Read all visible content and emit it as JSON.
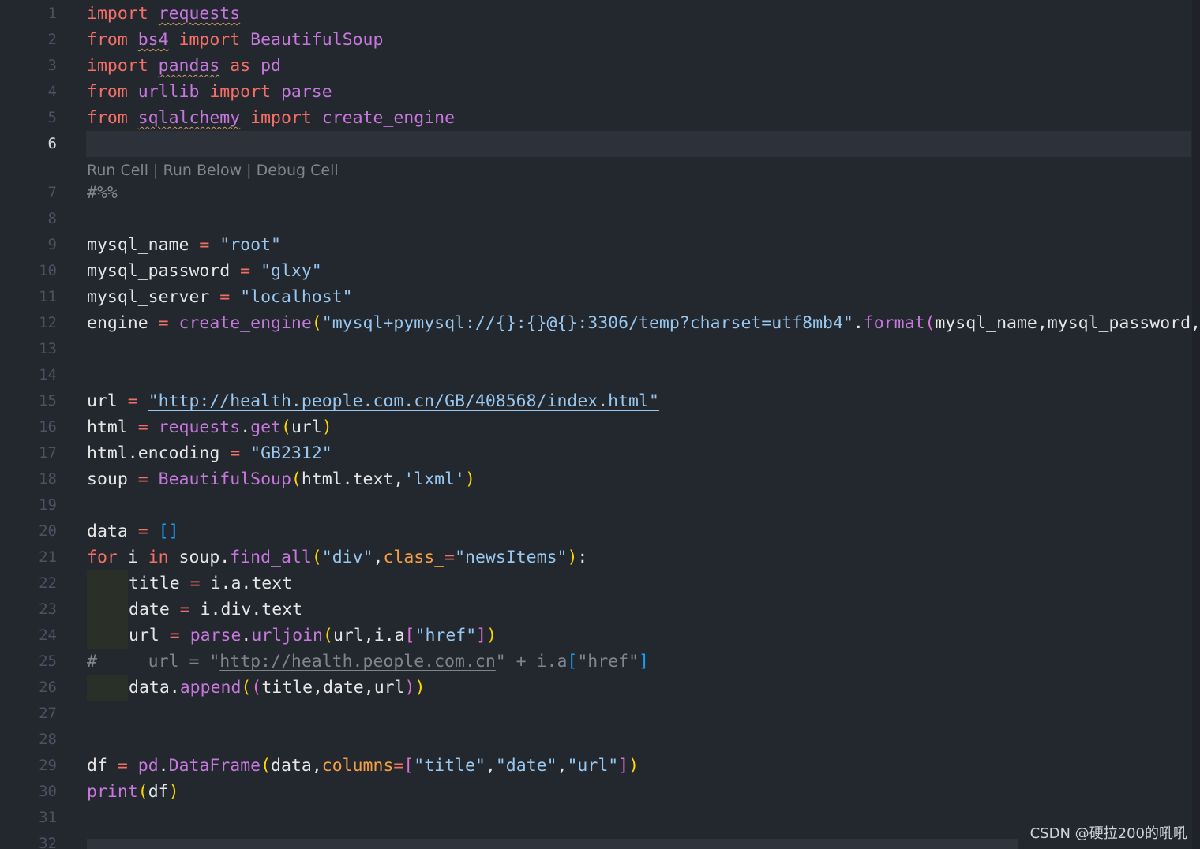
{
  "editor": {
    "current_line": "6",
    "codelens": {
      "run_cell": "Run Cell",
      "sep1": " | ",
      "run_below": "Run Below",
      "sep2": " | ",
      "debug_cell": "Debug Cell"
    },
    "line_numbers": [
      "1",
      "2",
      "3",
      "4",
      "5",
      "6",
      "7",
      "8",
      "9",
      "10",
      "11",
      "12",
      "13",
      "14",
      "15",
      "16",
      "17",
      "18",
      "19",
      "20",
      "21",
      "22",
      "23",
      "24",
      "25",
      "26",
      "27",
      "28",
      "29",
      "30",
      "31",
      "32"
    ],
    "lines": {
      "l1": [
        "import",
        " ",
        "requests"
      ],
      "l2": [
        "from",
        " ",
        "bs4",
        " ",
        "import",
        " BeautifulSoup"
      ],
      "l3": [
        "import",
        " ",
        "pandas",
        " ",
        "as",
        " pd"
      ],
      "l4": [
        "from",
        " urllib ",
        "import",
        " parse"
      ],
      "l5": [
        "from",
        " ",
        "sqlalchemy",
        " ",
        "import",
        " create_engine"
      ],
      "l7": [
        "#%%"
      ],
      "l9": [
        "mysql_name ",
        "=",
        " ",
        "\"root\""
      ],
      "l10": [
        "mysql_password ",
        "=",
        " ",
        "\"glxy\""
      ],
      "l11": [
        "mysql_server ",
        "=",
        " ",
        "\"localhost\""
      ],
      "l12": [
        "engine ",
        "=",
        " ",
        "create_engine",
        "(",
        "\"mysql+pymysql://{}:{}@{}:3306/temp?charset=utf8mb4\"",
        ".",
        "format",
        "(",
        "mysql_name,mysql_password,mysql_server"
      ],
      "l15": [
        "url ",
        "=",
        " ",
        "\"http://health.people.com.cn/GB/408568/index.html\""
      ],
      "l16": [
        "html ",
        "=",
        " ",
        "requests",
        ".",
        "get",
        "(",
        "url",
        ")"
      ],
      "l17": [
        "html.encoding ",
        "=",
        " ",
        "\"GB2312\""
      ],
      "l18": [
        "soup ",
        "=",
        " ",
        "BeautifulSoup",
        "(",
        "html.text,",
        "'lxml'",
        ")"
      ],
      "l20": [
        "data ",
        "=",
        " ",
        "[]"
      ],
      "l21": [
        "for",
        " i ",
        "in",
        " soup.",
        "find_all",
        "(",
        "\"div\"",
        ",",
        "class_",
        "=",
        "\"newsItems\"",
        ")",
        ":"
      ],
      "l22": [
        "title ",
        "=",
        " i.a.text"
      ],
      "l23": [
        "date ",
        "=",
        " i.div.text"
      ],
      "l24": [
        "url ",
        "=",
        " ",
        "parse",
        ".",
        "urljoin",
        "(",
        "url,i.a",
        "[",
        "\"href\"",
        "]",
        ")"
      ],
      "l25": [
        "#     url = \"",
        "http://health.people.com.cn",
        "\" + i.a",
        "[",
        "\"href\"",
        "]"
      ],
      "l26": [
        "data.",
        "append",
        "(",
        "(",
        "title,date,url",
        ")",
        ")"
      ],
      "l29": [
        "df ",
        "=",
        " ",
        "pd",
        ".",
        "DataFrame",
        "(",
        "data,",
        "columns",
        "=",
        "[",
        "\"title\"",
        ",",
        "\"date\"",
        ",",
        "\"url\"",
        "]",
        ")"
      ],
      "l30": [
        "print",
        "(",
        "df",
        ")"
      ]
    }
  },
  "watermark": "CSDN @硬拉200的吼吼",
  "colors": {
    "background": "#23272e",
    "keyword": "#f47067",
    "function": "#c678dd",
    "string": "#98c8f0",
    "comment": "#7f848e",
    "bracket_gold": "#ffd700",
    "bracket_pink": "#da70d6",
    "bracket_blue": "#179fff"
  }
}
